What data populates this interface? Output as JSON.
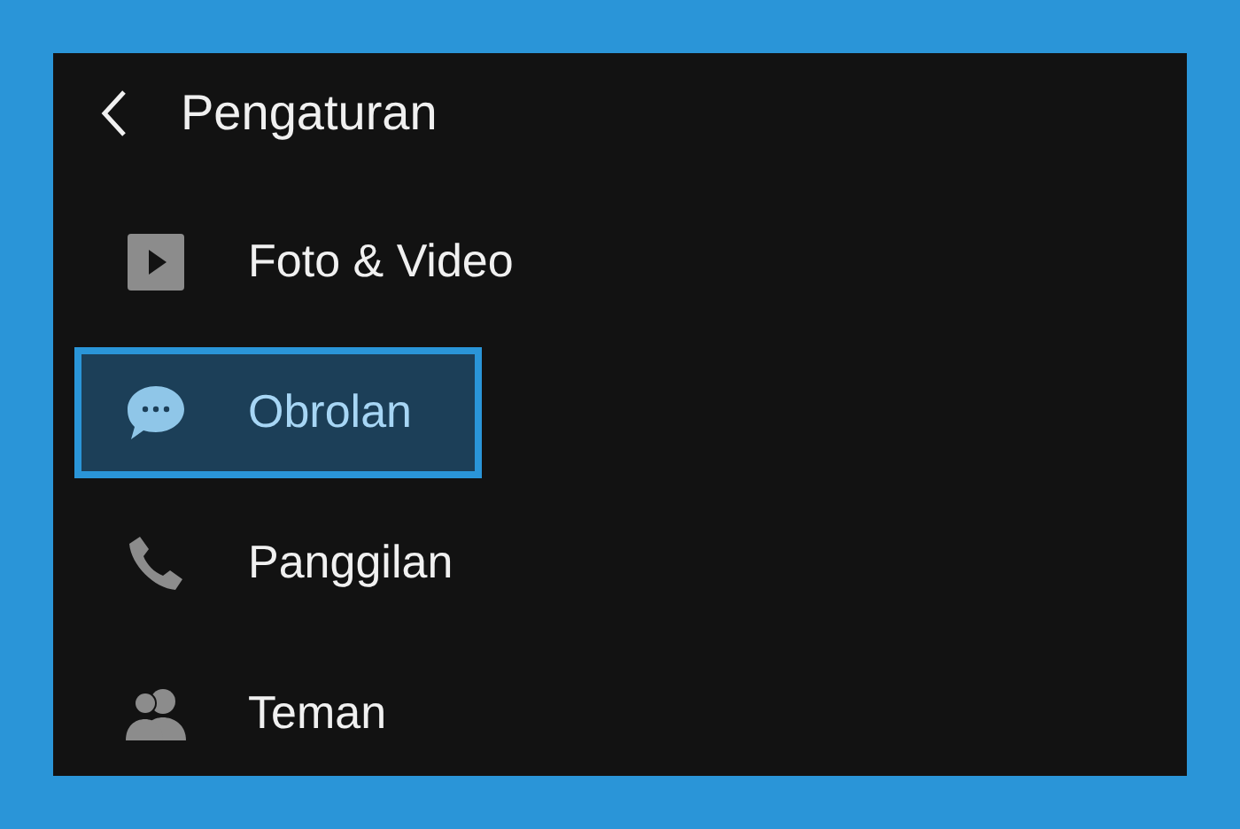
{
  "header": {
    "title": "Pengaturan"
  },
  "items": [
    {
      "label": "Foto & Video",
      "selected": false
    },
    {
      "label": "Obrolan",
      "selected": true
    },
    {
      "label": "Panggilan",
      "selected": false
    },
    {
      "label": "Teman",
      "selected": false
    }
  ]
}
